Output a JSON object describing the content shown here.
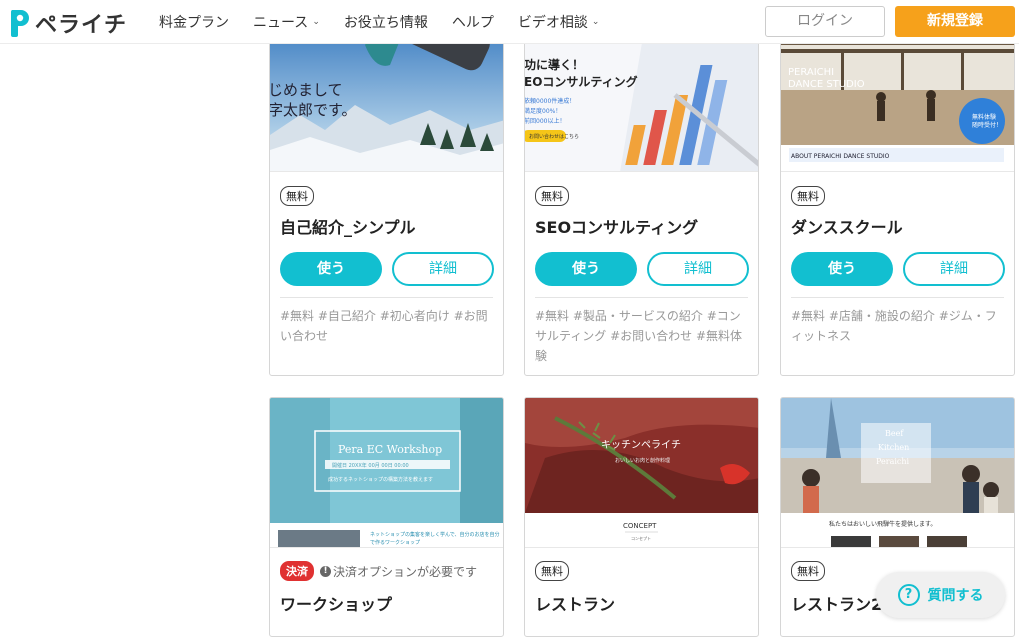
{
  "header": {
    "logo_text": "ペライチ",
    "nav": [
      {
        "label": "料金プラン",
        "has_menu": false
      },
      {
        "label": "ニュース",
        "has_menu": true
      },
      {
        "label": "お役立ち情報",
        "has_menu": false
      },
      {
        "label": "ヘルプ",
        "has_menu": false
      },
      {
        "label": "ビデオ相談",
        "has_menu": true
      }
    ],
    "login_label": "ログイン",
    "signup_label": "新規登録"
  },
  "colors": {
    "accent": "#12bfd0",
    "signup": "#f6a11b",
    "paid_badge": "#e03131"
  },
  "cards": [
    {
      "badge": "無料",
      "title": "自己紹介_シンプル",
      "use_label": "使う",
      "detail_label": "詳細",
      "tags": "#無料 #自己紹介 #初心者向け #お問い合わせ",
      "thumb": {
        "line1": "じめまして",
        "line2": "字太郎です。"
      }
    },
    {
      "badge": "無料",
      "title": "SEOコンサルティング",
      "use_label": "使う",
      "detail_label": "詳細",
      "tags": "#無料 #製品・サービスの紹介 #コンサルティング #お問い合わせ #無料体験",
      "thumb": {
        "line1": "功に導く！",
        "line2": "EOコンサルティング",
        "bullet1": "依頼0000件達成！",
        "bullet2": "満足度00%！",
        "bullet3": "前回000以上！",
        "button": "お問い合わせはこちら"
      }
    },
    {
      "badge": "無料",
      "title": "ダンススクール",
      "use_label": "使う",
      "detail_label": "詳細",
      "tags": "#無料 #店舗・施設の紹介 #ジム・フィットネス",
      "thumb": {
        "name1": "PERAICHI",
        "name2": "DANCE STUDIO",
        "circle1": "無料体験",
        "circle2": "随時受付！",
        "about": "ABOUT PERAICHI DANCE STUDIO"
      }
    },
    {
      "badge": "決済",
      "note": "決済オプションが必要です",
      "title": "ワークショップ",
      "thumb": {
        "title": "Pera EC Workshop",
        "sub": "開催日 20XX年 00月 00日 00:00",
        "line": "成功するネットショップの構築方法を教えます",
        "desc1": "ネットショップの集客を楽しく学んで、自分のお店を自分",
        "desc2": "で作るワークショップ"
      }
    },
    {
      "badge": "無料",
      "title": "レストラン",
      "thumb": {
        "title": "キッチンペライチ",
        "sub": "おいしいお肉と創作料理",
        "concept": "CONCEPT",
        "concept_sub": "コンセプト"
      }
    },
    {
      "badge": "無料",
      "title": "レストラン2",
      "thumb": {
        "l1": "Beef",
        "l2": "Kitchen",
        "l3": "Peraichi",
        "caption": "私たちはおいしい飛騨牛を提供します。"
      }
    }
  ],
  "help": {
    "label": "質問する",
    "icon": "?"
  }
}
